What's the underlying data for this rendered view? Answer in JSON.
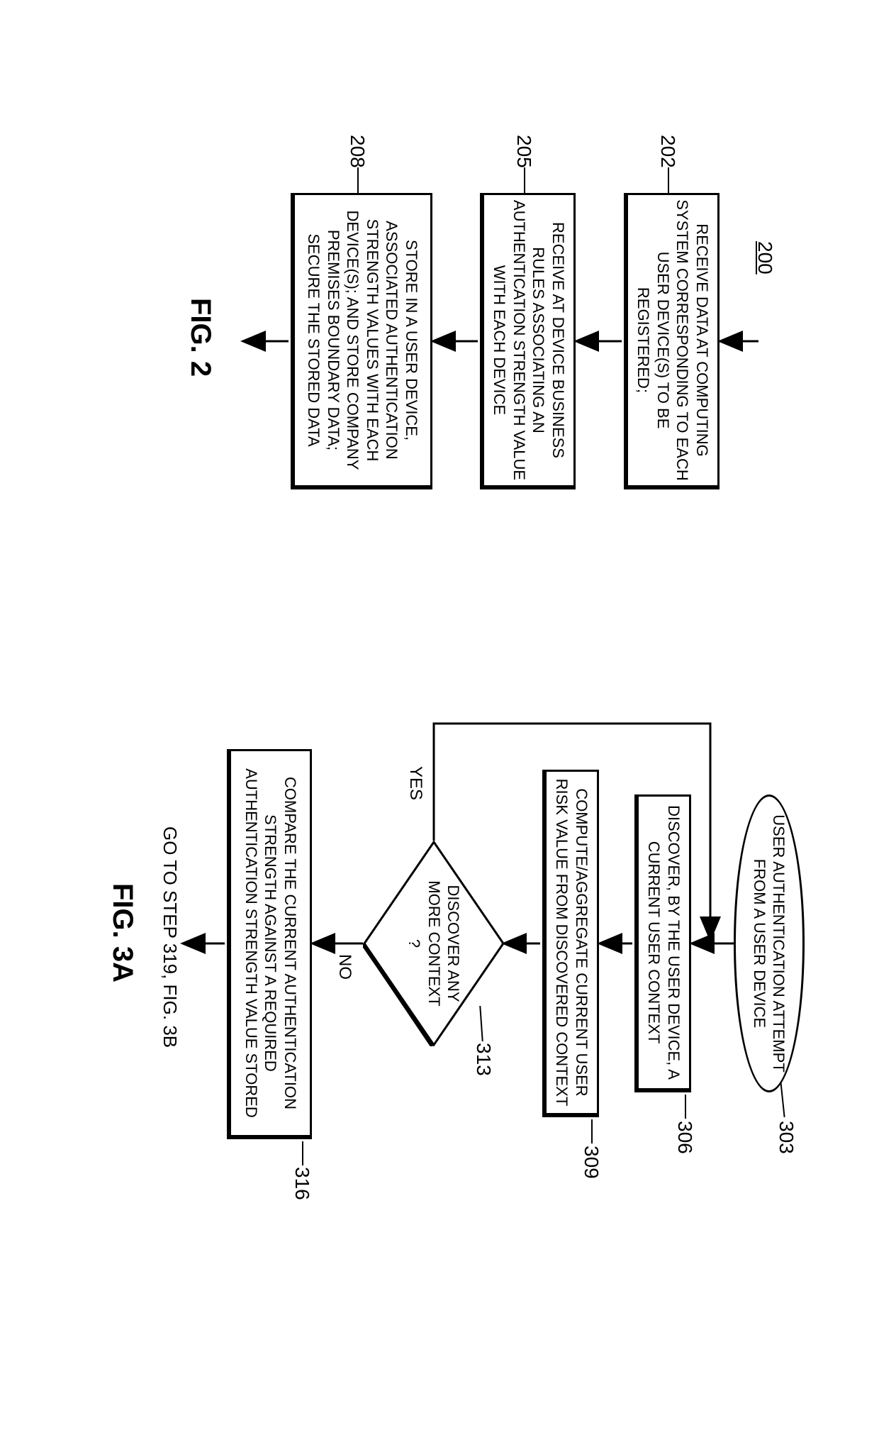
{
  "fig2": {
    "title": "FIG. 2",
    "ref": "200",
    "boxes": {
      "b202": {
        "num": "202",
        "text": "RECEIVE DATA AT COMPUTING SYSTEM CORRESPONDING TO EACH USER DEVICE(S) TO BE REGISTERED;"
      },
      "b205": {
        "num": "205",
        "text": "RECEIVE AT DEVICE BUSINESS RULES ASSOCIATING AN AUTHENTICATION STRENGTH VALUE WITH EACH DEVICE"
      },
      "b208": {
        "num": "208",
        "text": "STORE IN A USER DEVICE, ASSOCIATED AUTHENTICATION STRENGTH VALUES WITH EACH DEVICE(S); AND STORE COMPANY PREMISES BOUNDARY DATA; SECURE THE STORED DATA"
      }
    }
  },
  "fig3a": {
    "title": "FIG. 3A",
    "boxes": {
      "b303": {
        "num": "303",
        "text": "USER AUTHENTICATION ATTEMPT FROM A USER DEVICE"
      },
      "b306": {
        "num": "306",
        "text": "DISCOVER, BY THE USER DEVICE, A CURRENT USER CONTEXT"
      },
      "b309": {
        "num": "309",
        "text": "COMPUTE/AGGREGATE CURRENT USER RISK VALUE FROM DISCOVERED CONTEXT"
      },
      "b313": {
        "num": "313",
        "text": "DISCOVER ANY MORE CONTEXT ?"
      },
      "b316": {
        "num": "316",
        "text": "COMPARE THE CURRENT AUTHENTICATION STRENGTH AGAINST A REQUIRED AUTHENTICATION STRENGTH VALUE STORED"
      }
    },
    "labels": {
      "yes": "YES",
      "no": "NO",
      "goto": "GO TO STEP 319, FIG. 3B"
    }
  }
}
